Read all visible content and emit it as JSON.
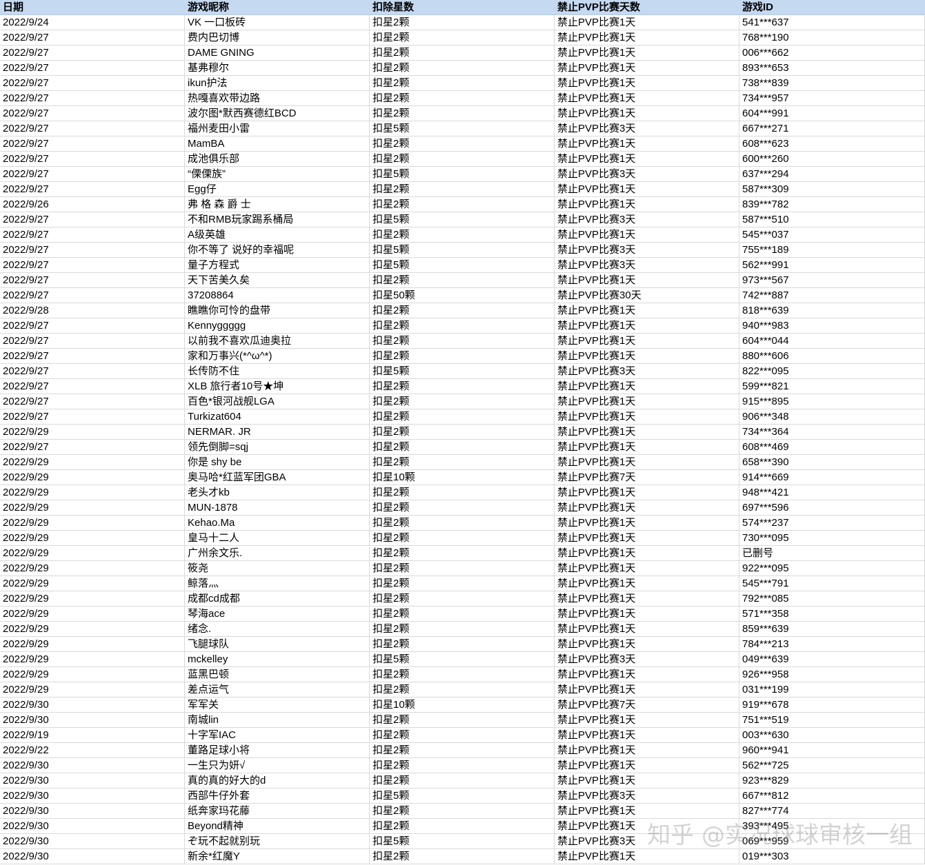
{
  "columns": [
    "日期",
    "游戏昵称",
    "扣除星数",
    "禁止PVP比赛天数",
    "游戏ID"
  ],
  "rows": [
    [
      "2022/9/24",
      "VK 一口板砖",
      "扣星2颗",
      "禁止PVP比赛1天",
      "541***637"
    ],
    [
      "2022/9/27",
      "费内巴切博",
      "扣星2颗",
      "禁止PVP比赛1天",
      "768***190"
    ],
    [
      "2022/9/27",
      "DAME GNING",
      "扣星2颗",
      "禁止PVP比赛1天",
      "006***662"
    ],
    [
      "2022/9/27",
      "基弗穆尔",
      "扣星2颗",
      "禁止PVP比赛1天",
      "893***653"
    ],
    [
      "2022/9/27",
      "ikun护法",
      "扣星2颗",
      "禁止PVP比赛1天",
      "738***839"
    ],
    [
      "2022/9/27",
      "热嘎喜欢带边路",
      "扣星2颗",
      "禁止PVP比赛1天",
      "734***957"
    ],
    [
      "2022/9/27",
      "波尔图*默西赛德红BCD",
      "扣星2颗",
      "禁止PVP比赛1天",
      "604***991"
    ],
    [
      "2022/9/27",
      "福州麦田小雷",
      "扣星5颗",
      "禁止PVP比赛3天",
      "667***271"
    ],
    [
      "2022/9/27",
      "MamBA",
      "扣星2颗",
      "禁止PVP比赛1天",
      "608***623"
    ],
    [
      "2022/9/27",
      "成池俱乐部",
      "扣星2颗",
      "禁止PVP比赛1天",
      "600***260"
    ],
    [
      "2022/9/27",
      " “傈傈族”",
      "扣星5颗",
      "禁止PVP比赛3天",
      "637***294"
    ],
    [
      "2022/9/27",
      "Egg仔",
      "扣星2颗",
      "禁止PVP比赛1天",
      "587***309"
    ],
    [
      "2022/9/26",
      "弗 格 森 爵 士",
      "扣星2颗",
      "禁止PVP比赛1天",
      "839***782"
    ],
    [
      "2022/9/27",
      "不和RMB玩家踢系桶局",
      "扣星5颗",
      "禁止PVP比赛3天",
      "587***510"
    ],
    [
      "2022/9/27",
      "A级英雄",
      "扣星2颗",
      "禁止PVP比赛1天",
      "545***037"
    ],
    [
      "2022/9/27",
      "你不等了 说好的幸福呢",
      "扣星5颗",
      "禁止PVP比赛3天",
      "755***189"
    ],
    [
      "2022/9/27",
      "量子方程式",
      "扣星5颗",
      "禁止PVP比赛3天",
      "562***991"
    ],
    [
      "2022/9/27",
      "天下苦美久矣",
      "扣星2颗",
      "禁止PVP比赛1天",
      "973***567"
    ],
    [
      "2022/9/27",
      "37208864",
      "扣星50颗",
      "禁止PVP比赛30天",
      "742***887"
    ],
    [
      "2022/9/28",
      "瞧瞧你可怜的盘带",
      "扣星2颗",
      "禁止PVP比赛1天",
      "818***639"
    ],
    [
      "2022/9/27",
      "Kennyggggg",
      "扣星2颗",
      "禁止PVP比赛1天",
      "940***983"
    ],
    [
      "2022/9/27",
      "以前我不喜欢瓜迪奥拉",
      "扣星2颗",
      "禁止PVP比赛1天",
      "604***044"
    ],
    [
      "2022/9/27",
      "家和万事兴(*^ω^*)",
      "扣星2颗",
      "禁止PVP比赛1天",
      "880***606"
    ],
    [
      "2022/9/27",
      "长传防不住",
      "扣星5颗",
      "禁止PVP比赛3天",
      "822***095"
    ],
    [
      "2022/9/27",
      "XLB 旅行者10号★坤",
      "扣星2颗",
      "禁止PVP比赛1天",
      "599***821"
    ],
    [
      "2022/9/27",
      "百色*银河战舰LGA",
      "扣星2颗",
      "禁止PVP比赛1天",
      "915***895"
    ],
    [
      "2022/9/27",
      "Turkizat604",
      "扣星2颗",
      "禁止PVP比赛1天",
      "906***348"
    ],
    [
      "2022/9/29",
      "NERMAR. JR",
      "扣星2颗",
      "禁止PVP比赛1天",
      "734***364"
    ],
    [
      "2022/9/27",
      "领先倒脚=sqj",
      "扣星2颗",
      "禁止PVP比赛1天",
      "608***469"
    ],
    [
      "2022/9/29",
      "你是 shy be",
      "扣星2颗",
      "禁止PVP比赛1天",
      "658***390"
    ],
    [
      "2022/9/29",
      "奥马哈*红蓝军团GBA",
      "扣星10颗",
      "禁止PVP比赛7天",
      "914***669"
    ],
    [
      "2022/9/29",
      "老头才kb",
      "扣星2颗",
      "禁止PVP比赛1天",
      "948***421"
    ],
    [
      "2022/9/29",
      "MUN-1878",
      "扣星2颗",
      "禁止PVP比赛1天",
      "697***596"
    ],
    [
      "2022/9/29",
      "Kehao.Ma",
      "扣星2颗",
      "禁止PVP比赛1天",
      "574***237"
    ],
    [
      "2022/9/29",
      "皇马十二人",
      "扣星2颗",
      "禁止PVP比赛1天",
      "730***095"
    ],
    [
      "2022/9/29",
      "广州余文乐.",
      "扣星2颗",
      "禁止PVP比赛1天",
      "已删号"
    ],
    [
      "2022/9/29",
      "筱尧",
      "扣星2颗",
      "禁止PVP比赛1天",
      "922***095"
    ],
    [
      "2022/9/29",
      "鲸落灬",
      "扣星2颗",
      "禁止PVP比赛1天",
      "545***791"
    ],
    [
      "2022/9/29",
      "成都cd成都",
      "扣星2颗",
      "禁止PVP比赛1天",
      "792***085"
    ],
    [
      "2022/9/29",
      "琴海ace",
      "扣星2颗",
      "禁止PVP比赛1天",
      "571***358"
    ],
    [
      "2022/9/29",
      "绪念.",
      "扣星2颗",
      "禁止PVP比赛1天",
      "859***639"
    ],
    [
      "2022/9/29",
      "飞腿球队",
      "扣星2颗",
      "禁止PVP比赛1天",
      "784***213"
    ],
    [
      "2022/9/29",
      "mckelley",
      "扣星5颗",
      "禁止PVP比赛3天",
      "049***639"
    ],
    [
      "2022/9/29",
      "蓝黑巴顿",
      "扣星2颗",
      "禁止PVP比赛1天",
      "926***958"
    ],
    [
      "2022/9/29",
      "差点运气",
      "扣星2颗",
      "禁止PVP比赛1天",
      "031***199"
    ],
    [
      "2022/9/30",
      "军军关",
      "扣星10颗",
      "禁止PVP比赛7天",
      "919***678"
    ],
    [
      "2022/9/30",
      "南城lin",
      "扣星2颗",
      "禁止PVP比赛1天",
      "751***519"
    ],
    [
      "2022/9/19",
      "十字军IAC",
      "扣星2颗",
      "禁止PVP比赛1天",
      "003***630"
    ],
    [
      "2022/9/22",
      "董路足球小将",
      "扣星2颗",
      "禁止PVP比赛1天",
      "960***941"
    ],
    [
      "2022/9/30",
      "一生只为妍√",
      "扣星2颗",
      "禁止PVP比赛1天",
      "562***725"
    ],
    [
      "2022/9/30",
      "真的真的好大的d",
      "扣星2颗",
      "禁止PVP比赛1天",
      "923***829"
    ],
    [
      "2022/9/30",
      "西部牛仔外套",
      "扣星5颗",
      "禁止PVP比赛3天",
      "667***812"
    ],
    [
      "2022/9/30",
      "纸奔家玛花藤",
      "扣星2颗",
      "禁止PVP比赛1天",
      "827***774"
    ],
    [
      "2022/9/30",
      "Beyond精神",
      "扣星2颗",
      "禁止PVP比赛1天",
      "393***495"
    ],
    [
      "2022/9/30",
      "ぞ玩不起就别玩",
      "扣星5颗",
      "禁止PVP比赛3天",
      "069***959"
    ],
    [
      "2022/9/30",
      "新余*红魔Y",
      "扣星2颗",
      "禁止PVP比赛1天",
      "019***303"
    ]
  ],
  "watermark": "知乎 @实况球球审核一组",
  "colors": {
    "header_bg": "#c5d9f1",
    "grid": "#d9d9d9"
  }
}
